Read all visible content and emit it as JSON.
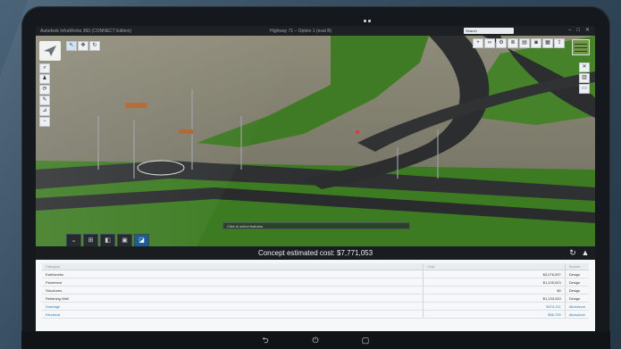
{
  "app": {
    "title": "Autodesk InfraWorks 360 (CONNECT Edition)",
    "document_title": "Highway 71 – Option 1 (eval B)",
    "search_placeholder": "Search"
  },
  "window_controls": [
    "–",
    "□",
    "✕"
  ],
  "toolbars": {
    "left_row": [
      {
        "icon": "select-icon",
        "glyph": "↖"
      },
      {
        "icon": "pan-icon",
        "glyph": "✥"
      },
      {
        "icon": "orbit-icon",
        "glyph": "↻"
      }
    ],
    "left_column": [
      {
        "icon": "zoom-icon",
        "glyph": "⌕"
      },
      {
        "icon": "person-icon",
        "glyph": "♟"
      },
      {
        "icon": "rotate-icon",
        "glyph": "⟳"
      },
      {
        "icon": "pen-icon",
        "glyph": "✎"
      },
      {
        "icon": "measure-icon",
        "glyph": "⊿"
      },
      {
        "icon": "minus-icon",
        "glyph": "−"
      }
    ],
    "right_row": [
      {
        "icon": "plus-icon",
        "glyph": "+"
      },
      {
        "icon": "link-icon",
        "glyph": "∞"
      },
      {
        "icon": "settings-icon",
        "glyph": "⚙"
      },
      {
        "icon": "layers-icon",
        "glyph": "≣"
      },
      {
        "icon": "document-icon",
        "glyph": "▤"
      },
      {
        "icon": "camera-icon",
        "glyph": "◙"
      },
      {
        "icon": "grid-icon",
        "glyph": "▦"
      },
      {
        "icon": "export-icon",
        "glyph": "⇪"
      }
    ],
    "right_column": [
      {
        "icon": "close-icon",
        "glyph": "✕"
      },
      {
        "icon": "chart-icon",
        "glyph": "▥"
      },
      {
        "icon": "panel-icon",
        "glyph": "▭"
      }
    ],
    "bottom": [
      {
        "icon": "collapse-icon",
        "glyph": "⌄"
      },
      {
        "icon": "layout-icon",
        "glyph": "⊞"
      },
      {
        "icon": "cube-icon",
        "glyph": "◧"
      },
      {
        "icon": "stack-icon",
        "glyph": "▣"
      },
      {
        "icon": "analytics-icon",
        "glyph": "◪"
      }
    ]
  },
  "viewport": {
    "status_text": "Click to select features"
  },
  "cost": {
    "label": "Concept estimated cost: $7,771,053",
    "refresh_icon": "↻",
    "chart_icon": "▲"
  },
  "table": {
    "columns": [
      "Category",
      "Cost",
      "Source"
    ],
    "rows": [
      {
        "category": "Earthworks",
        "cost": "$3,076,597",
        "source": "Design",
        "link": false
      },
      {
        "category": "Pavement",
        "cost": "$1,105,523",
        "source": "Design",
        "link": false
      },
      {
        "category": "Structures",
        "cost": "$0",
        "source": "Design",
        "link": false
      },
      {
        "category": "Retaining Wall",
        "cost": "$1,153,020",
        "source": "Design",
        "link": false
      },
      {
        "category": "Drainage",
        "cost": "$374,211",
        "source": "Allowance",
        "link": true
      },
      {
        "category": "Electrical",
        "cost": "$56,739",
        "source": "Allowance",
        "link": true
      }
    ]
  },
  "device_nav": {
    "back": "⮌",
    "power": "⏻",
    "home": "▢"
  },
  "colors": {
    "grass": "#4e8a2e",
    "asphalt": "#2b2d2f",
    "terrain": "#7e7c6c",
    "link": "#2f7bbf"
  }
}
